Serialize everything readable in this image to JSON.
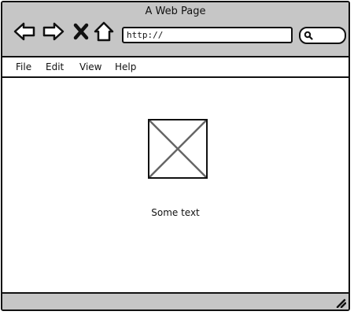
{
  "window": {
    "title": "A Web Page"
  },
  "toolbar": {
    "back_icon": "back-arrow-icon",
    "forward_icon": "forward-arrow-icon",
    "stop_icon": "close-x-icon",
    "home_icon": "home-icon",
    "url_value": "http://",
    "search_icon": "magnifier-icon"
  },
  "menu": {
    "items": [
      "File",
      "Edit",
      "View",
      "Help"
    ]
  },
  "content": {
    "image_icon": "image-placeholder-icon",
    "text": "Some text"
  },
  "statusbar": {
    "resize_icon": "resize-grip-icon"
  },
  "colors": {
    "chrome": "#c6c6c6",
    "border": "#111111",
    "background": "#ffffff",
    "placeholder_cross": "#666666"
  }
}
